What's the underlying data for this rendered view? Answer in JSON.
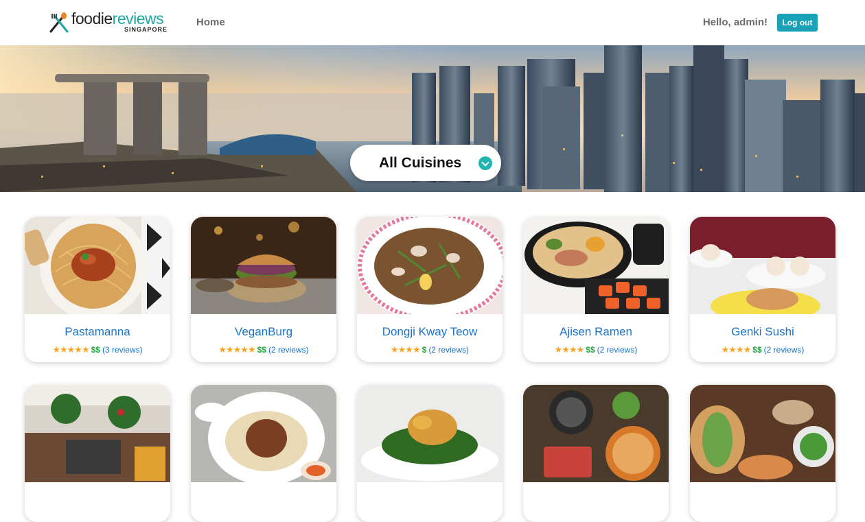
{
  "brand": {
    "word1": "foodie",
    "word2": "reviews",
    "sub": "SINGAPORE"
  },
  "nav": {
    "home": "Home",
    "greeting": "Hello, admin!",
    "logout": "Log out"
  },
  "hero": {
    "cuisine_selected": "All Cuisines"
  },
  "restaurants": [
    {
      "name": "Pastamanna",
      "rating": "★★★★★",
      "price": "$$",
      "reviews": "(3 reviews)"
    },
    {
      "name": "VeganBurg",
      "rating": "★★★★★",
      "price": "$$",
      "reviews": "(2 reviews)"
    },
    {
      "name": "Dongji Kway Teow",
      "rating": "★★★★",
      "price": "$",
      "reviews": "(2 reviews)"
    },
    {
      "name": "Ajisen Ramen",
      "rating": "★★★★",
      "price": "$$",
      "reviews": "(2 reviews)"
    },
    {
      "name": "Genki Sushi",
      "rating": "★★★★",
      "price": "$$",
      "reviews": "(2 reviews)"
    }
  ],
  "colors": {
    "accent": "#17a2b8",
    "link": "#1a73c9",
    "star": "#f5a623",
    "price": "#28a745"
  }
}
